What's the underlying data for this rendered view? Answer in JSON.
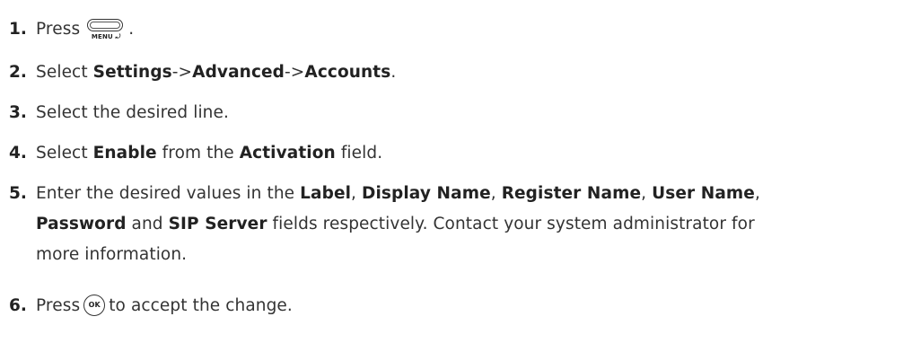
{
  "steps": [
    {
      "number": "1.",
      "pre": "Press",
      "key_label": "MENU ⤾",
      "post": "."
    },
    {
      "number": "2.",
      "pre": "Select",
      "path": [
        "Settings",
        "->",
        "Advanced",
        "->",
        "Accounts"
      ],
      "post": "."
    },
    {
      "number": "3.",
      "text": "Select the desired line."
    },
    {
      "number": "4.",
      "pre": "Select",
      "bold1": "Enable",
      "mid": "from the",
      "bold2": "Activation",
      "post": "field."
    },
    {
      "number": "5.",
      "line1_pre": "Enter the desired values in the",
      "fields": [
        "Label",
        "Display Name",
        "Register Name",
        "User Name",
        "Password",
        "SIP Server"
      ],
      "line2_post": "fields respectively. Contact your system administrator for",
      "line3": "more information."
    },
    {
      "number": "6.",
      "pre": "Press",
      "key_label": "OK",
      "post": "to accept the change."
    }
  ]
}
